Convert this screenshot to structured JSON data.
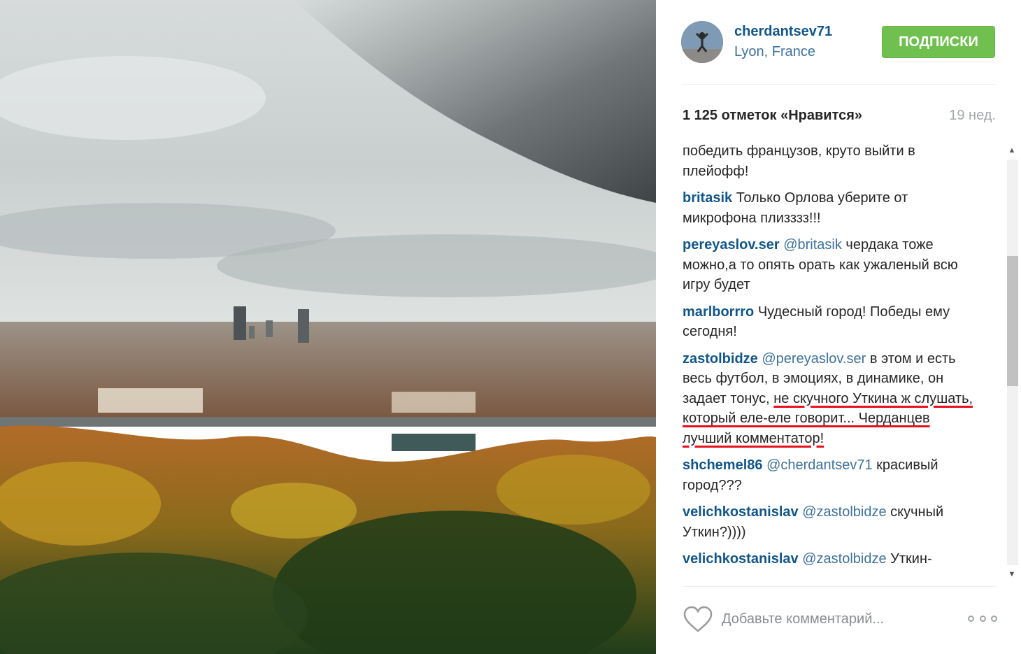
{
  "post": {
    "username": "cherdantsev71",
    "location": "Lyon, France",
    "follow_label": "ПОДПИСКИ",
    "likes": "1 125 отметок «Нравится»",
    "time": "19 нед."
  },
  "comments": [
    {
      "user": "",
      "mention": "",
      "text": "победить французов, круто выйти в плейофф!"
    },
    {
      "user": "britasik",
      "mention": "",
      "text": "Только Орлова уберите от микрофона плизззз!!!"
    },
    {
      "user": "pereyaslov.ser",
      "mention": "@britasik",
      "text": "чердака тоже можно,а то опять орать как ужаленый всю игру будет"
    },
    {
      "user": "marlborrro",
      "mention": "",
      "text": "Чудесный город! Победы ему сегодня!"
    },
    {
      "user": "zastolbidze",
      "mention": "@pereyaslov.ser",
      "text": "в этом и есть весь футбол, в эмоциях, в динамике, он задает тонус,",
      "highlight": "не скучного Уткина ж слушать, который еле-еле говорит... Черданцев лучший комментатор!"
    },
    {
      "user": "shchemel86",
      "mention": "@cherdantsev71",
      "text": "красивый город???"
    },
    {
      "user": "velichkostanislav",
      "mention": "@zastolbidze",
      "text": "скучный Уткин?))))"
    },
    {
      "user": "velichkostanislav",
      "mention": "@zastolbidze",
      "text": "Уткин-"
    }
  ],
  "footer": {
    "placeholder": "Добавьте комментарий..."
  },
  "icons": [
    "heart-icon",
    "more-icon",
    "scroll-up-icon",
    "scroll-down-icon"
  ],
  "colors": {
    "username": "#125688",
    "follow_button": "#70c050",
    "underline": "#e8101c"
  }
}
